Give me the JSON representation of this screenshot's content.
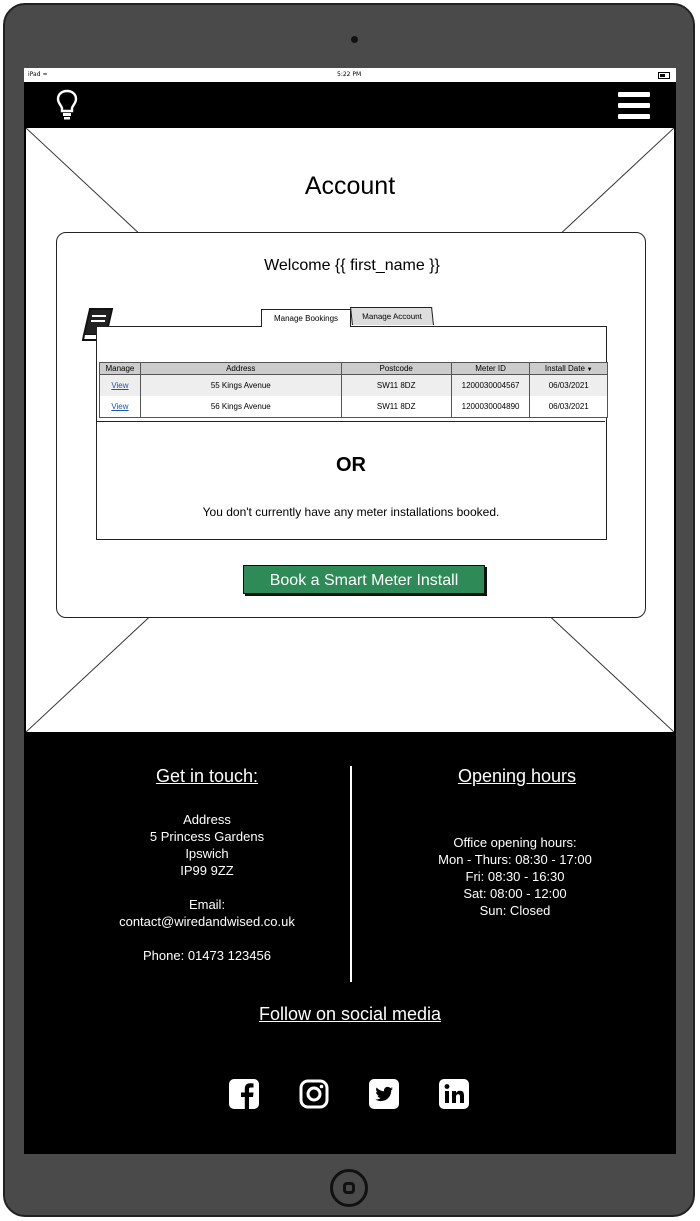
{
  "status_bar": {
    "device": "iPad",
    "time": "5:22 PM"
  },
  "page": {
    "title": "Account"
  },
  "account": {
    "welcome": "Welcome {{ first_name }}",
    "tabs": [
      "Manage Bookings",
      "Manage Account"
    ],
    "table": {
      "headers": [
        "Manage",
        "Address",
        "Postcode",
        "Meter ID",
        "Install Date"
      ],
      "rows": [
        {
          "manage": "View",
          "address": "55 Kings Avenue",
          "postcode": "SW11 8DZ",
          "meter_id": "1200030004567",
          "install_date": "06/03/2021"
        },
        {
          "manage": "View",
          "address": "56 Kings Avenue",
          "postcode": "SW11 8DZ",
          "meter_id": "1200030004890",
          "install_date": "06/03/2021"
        }
      ]
    },
    "or_text": "OR",
    "empty_message": "You don't currently have any meter installations booked.",
    "book_button": "Book a Smart Meter Install"
  },
  "footer": {
    "contact_title": "Get in touch:",
    "address_label": "Address",
    "address_lines": [
      "5 Princess Gardens",
      "Ipswich",
      "IP99 9ZZ"
    ],
    "email_label": "Email:",
    "email": "contact@wiredandwised.co.uk",
    "phone": "Phone:  01473 123456",
    "hours_title": "Opening hours",
    "hours_label": "Office opening hours:",
    "hours": [
      "Mon - Thurs:  08:30 - 17:00",
      "Fri:  08:30 - 16:30",
      "Sat:  08:00 - 12:00",
      "Sun:  Closed"
    ],
    "social_title": "Follow on social media",
    "social_icons": [
      "facebook-icon",
      "instagram-icon",
      "twitter-icon",
      "linkedin-icon"
    ]
  },
  "colors": {
    "accent": "#2e8b57",
    "link": "#1a57b5",
    "background_dark": "#000000",
    "device_frame": "#4a4a4a"
  }
}
